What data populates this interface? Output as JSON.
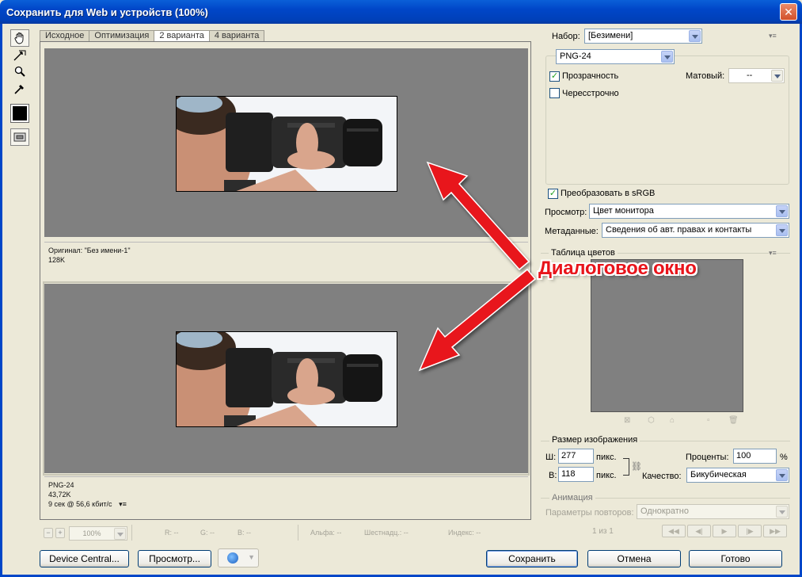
{
  "window": {
    "title": "Сохранить для Web и устройств (100%)",
    "close": "✕"
  },
  "tabs": [
    "Исходное",
    "Оптимизация",
    "2 варианта",
    "4 варианта"
  ],
  "active_tab": "2 варианта",
  "panes": {
    "top": {
      "line1": "Оригинал: \"Без имени-1\"",
      "line2": "128K"
    },
    "bottom": {
      "line1": "PNG-24",
      "line2": "43,72K",
      "line3": "9 сек @ 56,6 кбит/с"
    }
  },
  "annotation": "Диалоговое окно",
  "zoom": {
    "value": "100%",
    "minus": "−",
    "plus": "+"
  },
  "status": {
    "r": "R: --",
    "g": "G: --",
    "b": "B: --",
    "alpha": "Альфа: --",
    "hex": "Шестнадц.: --",
    "index": "Индекс: --"
  },
  "settings": {
    "preset_label": "Набор:",
    "preset_value": "[Безимени]",
    "format_value": "PNG-24",
    "transparency_label": "Прозрачность",
    "transparency_checked": true,
    "matte_label": "Матовый:",
    "matte_value": "--",
    "interlaced_label": "Чересстрочно",
    "interlaced_checked": false,
    "srgb_label": "Преобразовать в sRGB",
    "srgb_checked": true,
    "preview_label": "Просмотр:",
    "preview_value": "Цвет монитора",
    "metadata_label": "Метаданные:",
    "metadata_value": "Сведения об авт. правах и контакты"
  },
  "color_table": {
    "title": "Таблица цветов"
  },
  "image_size": {
    "title": "Размер изображения",
    "w_label": "Ш:",
    "w_value": "277",
    "w_unit": "пикс.",
    "h_label": "В:",
    "h_value": "118",
    "h_unit": "пикс.",
    "percent_label": "Проценты:",
    "percent_value": "100",
    "percent_unit": "%",
    "quality_label": "Качество:",
    "quality_value": "Бикубическая"
  },
  "animation": {
    "title": "Анимация",
    "loop_label": "Параметры повторов:",
    "loop_value": "Однократно",
    "frame_counter": "1 из 1"
  },
  "buttons": {
    "device_central": "Device Central...",
    "preview": "Просмотр...",
    "save": "Сохранить",
    "cancel": "Отмена",
    "done": "Готово"
  },
  "colors": {
    "accent_red": "#e8141b",
    "titlebar": "#0046c8",
    "canvas_gray": "#808080"
  }
}
